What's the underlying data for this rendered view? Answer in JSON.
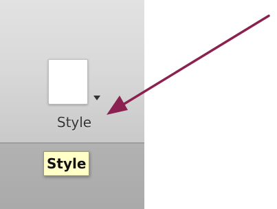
{
  "toolbar": {
    "style_button": {
      "label": "Style",
      "swatch_color": "#ffffff",
      "icon": "chevron-down-icon"
    }
  },
  "tooltip": {
    "text": "Style",
    "background": "#ffffc7"
  },
  "annotation": {
    "type": "arrow",
    "color": "#8b2150"
  }
}
